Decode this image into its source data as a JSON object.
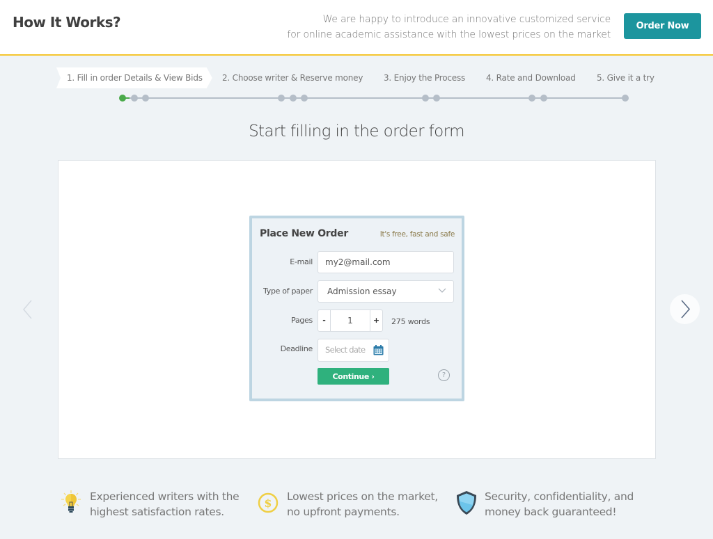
{
  "header": {
    "title": "How It Works?",
    "intro_line1": "We are happy to introduce an innovative customized service",
    "intro_line2": "for online academic assistance with the lowest prices on the market",
    "order_button": "Order Now",
    "accent_color": "#1c959e",
    "border_color": "#f5c52e"
  },
  "steps": [
    {
      "label": "1. Fill in order Details & View Bids",
      "active": true
    },
    {
      "label": "2. Choose writer & Reserve money",
      "active": false
    },
    {
      "label": "3. Enjoy the Process",
      "active": false
    },
    {
      "label": "4. Rate and Download",
      "active": false
    },
    {
      "label": "5. Give it a try",
      "active": false
    }
  ],
  "progress": {
    "current_step": 1,
    "current_substep": 1,
    "substeps_per_step": [
      3,
      3,
      2,
      2,
      1
    ]
  },
  "main": {
    "title": "Start filling in the order form"
  },
  "order_form": {
    "title": "Place New Order",
    "subtitle": "It's free, fast and safe",
    "email_label": "E-mail",
    "email_value": "my2@mail.com",
    "paper_label": "Type of paper",
    "paper_value": "Admission essay",
    "pages_label": "Pages",
    "pages_minus": "-",
    "pages_value": "1",
    "pages_plus": "+",
    "words": "275 words",
    "deadline_label": "Deadline",
    "deadline_placeholder": "Select date",
    "continue_button": "Continue ›",
    "help": "?",
    "continue_color": "#2fb17d"
  },
  "carousel": {
    "prev_icon": "chevron-left-icon",
    "next_icon": "chevron-right-icon"
  },
  "features": [
    {
      "icon": "lightbulb-icon",
      "line1": "Experienced writers with the",
      "line2": "highest satisfaction rates."
    },
    {
      "icon": "dollar-coin-icon",
      "line1": "Lowest prices on the market,",
      "line2": "no upfront payments."
    },
    {
      "icon": "shield-icon",
      "line1": "Security, confidentiality, and",
      "line2": "money back guaranteed!"
    }
  ]
}
